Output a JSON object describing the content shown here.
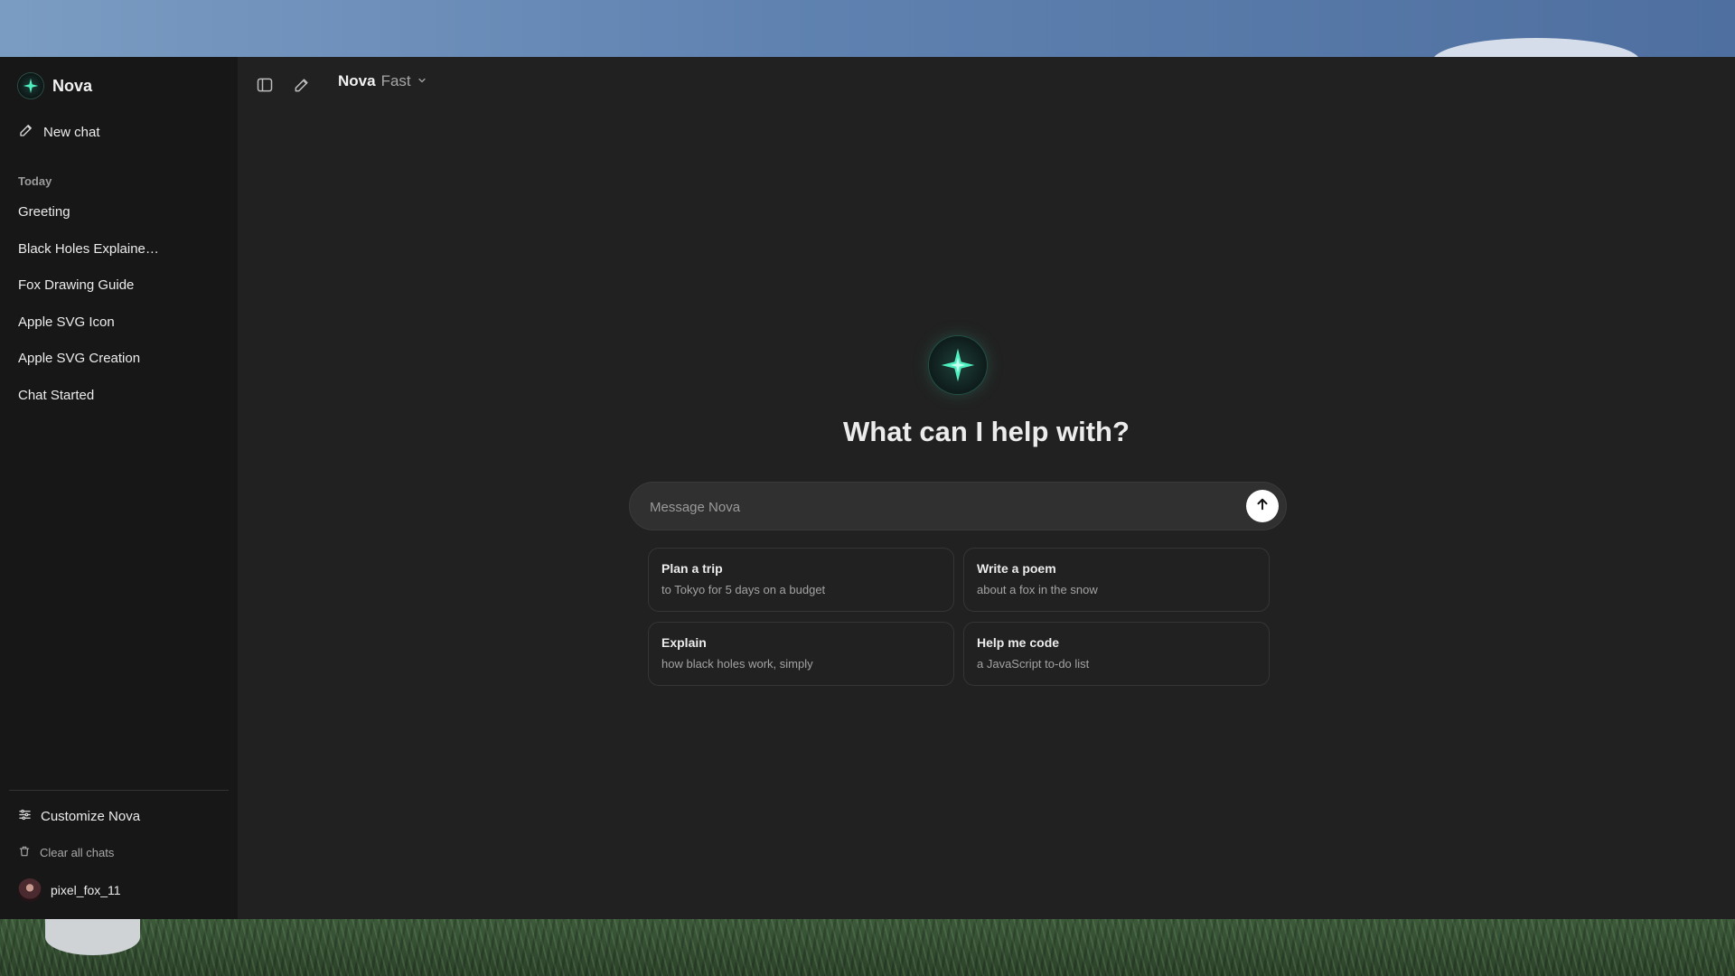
{
  "app": {
    "brand_name": "Nova",
    "new_chat_label": "New chat"
  },
  "sidebar": {
    "section_label": "Today",
    "items": [
      {
        "label": "Greeting"
      },
      {
        "label": "Black Holes Explaine…"
      },
      {
        "label": "Fox Drawing Guide"
      },
      {
        "label": "Apple SVG Icon"
      },
      {
        "label": "Apple SVG Creation"
      },
      {
        "label": "Chat Started"
      }
    ],
    "customize_label": "Customize Nova",
    "clear_label": "Clear all chats",
    "username": "pixel_fox_11"
  },
  "header": {
    "model_name": "Nova",
    "model_tier": "Fast"
  },
  "main": {
    "heading": "What can I help with?",
    "composer_placeholder": "Message Nova",
    "composer_value": ""
  },
  "suggestions": [
    {
      "title": "Plan a trip",
      "subtitle": "to Tokyo for 5 days on a budget"
    },
    {
      "title": "Write a poem",
      "subtitle": "about a fox in the snow"
    },
    {
      "title": "Explain",
      "subtitle": "how black holes work, simply"
    },
    {
      "title": "Help me code",
      "subtitle": "a JavaScript to-do list"
    }
  ],
  "colors": {
    "accent": "#4ff0c0",
    "sidebar_bg": "#171717",
    "main_bg": "#212121"
  },
  "icons": {
    "brand": "sparkle-icon",
    "new_chat": "pencil-icon",
    "sidebar_toggle": "sidebar-toggle-icon",
    "compose": "compose-icon",
    "model_dropdown": "chevron-down-icon",
    "send": "arrow-up-icon",
    "customize": "sliders-icon",
    "clear": "trash-icon"
  }
}
